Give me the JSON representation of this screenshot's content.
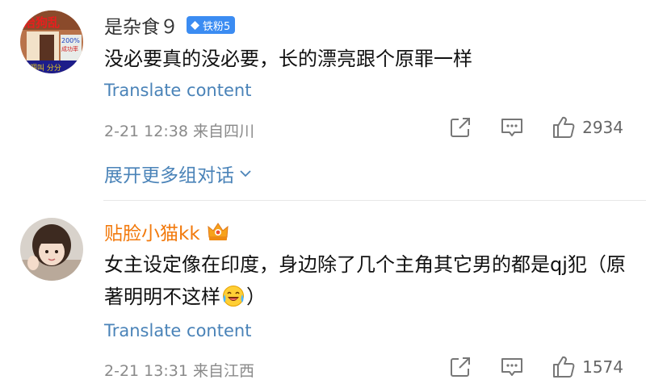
{
  "comments": [
    {
      "username": "是杂食９",
      "fan_badge": "铁粉5",
      "content": "没必要真的没必要，长的漂亮跟个原罪一样",
      "translate": "Translate content",
      "meta": "2-21 12:38  来自四川",
      "likes": "2934",
      "expand": "展开更多组对话"
    },
    {
      "username": "贴脸小猫kk",
      "content_before": "女主设定像在印度，身边除了几个主角其它男的都是qj犯（原著明明不这样",
      "content_after": "）",
      "translate": "Translate content",
      "meta": "2-21 13:31  来自江西",
      "likes": "1574"
    }
  ],
  "avatar1_text": {
    "line1": "治狗乱",
    "line2": "200%",
    "line3": "成功率",
    "line4": "调叫 分分"
  },
  "colors": {
    "link": "#4a83b8",
    "vip_name": "#f27a0d",
    "fan_badge": "#3b8cf2",
    "meta": "#8a8a8a"
  },
  "icons": [
    "share-icon",
    "reply-icon",
    "thumbs-up-icon",
    "chevron-down-icon",
    "crown-icon",
    "diamond-icon",
    "laughing-crying-emoji"
  ]
}
